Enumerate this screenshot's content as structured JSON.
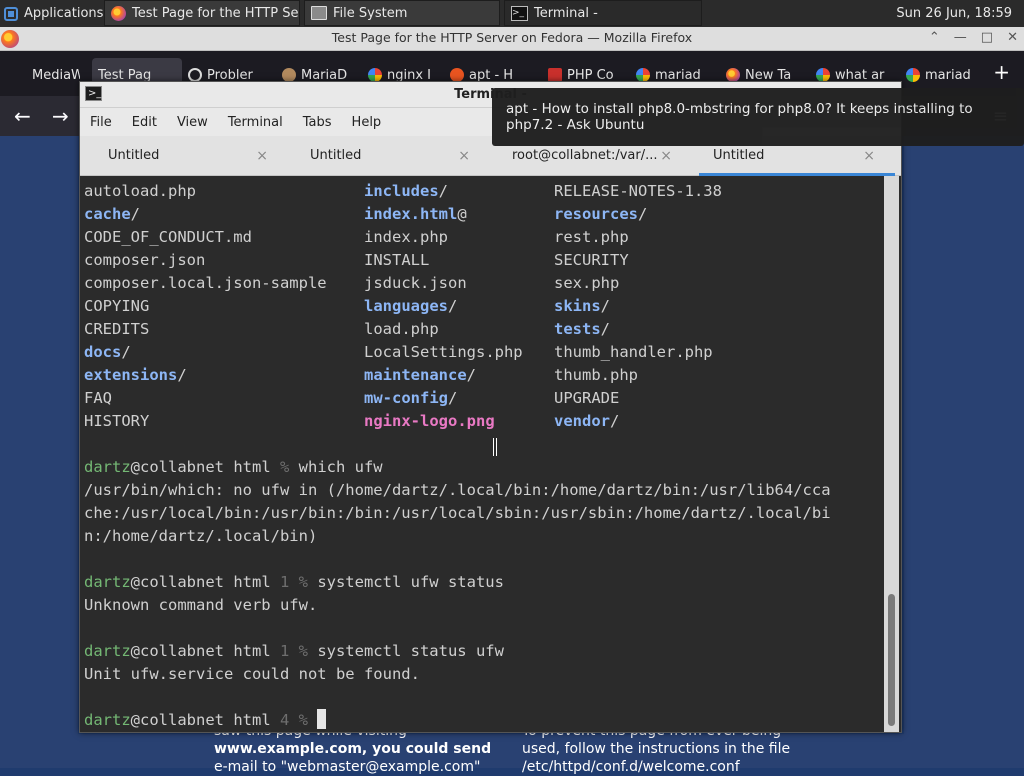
{
  "panel": {
    "apps_label": "Applications",
    "tasks": [
      {
        "label": "Test Page for the HTTP Se..."
      },
      {
        "label": "File System"
      },
      {
        "label": "Terminal -"
      }
    ],
    "clock": "Sun 26 Jun, 18:59"
  },
  "firefox": {
    "window_title": "Test Page for the HTTP Server on Fedora — Mozilla Firefox",
    "tabs": [
      {
        "label": "MediaW"
      },
      {
        "label": "Test Pag"
      },
      {
        "label": "Probler"
      },
      {
        "label": "MariaD"
      },
      {
        "label": "nginx I"
      },
      {
        "label": "apt - H"
      },
      {
        "label": "PHP Co"
      },
      {
        "label": "mariad"
      },
      {
        "label": "New Ta"
      },
      {
        "label": "what ar"
      },
      {
        "label": "mariad"
      }
    ],
    "new_tab": "+",
    "back": "←",
    "forward": "→",
    "menu": "≡",
    "page_left_text": [
      "saw this page while visiting",
      "www.example.com, you could send",
      "e-mail to \"webmaster@example.com\""
    ],
    "page_right_text": [
      "To prevent this page from ever being",
      "used, follow the instructions in the file",
      "/etc/httpd/conf.d/welcome.conf"
    ]
  },
  "tooltip": {
    "text": "apt - How to install php8.0-mbstring for php8.0? It keeps installing to php7.2 - Ask Ubuntu"
  },
  "terminal": {
    "title": "Terminal -",
    "menu": [
      "File",
      "Edit",
      "View",
      "Terminal",
      "Tabs",
      "Help"
    ],
    "tabs": [
      "Untitled",
      "Untitled",
      "root@collabnet:/var/...",
      "Untitled"
    ],
    "tab_close": "×",
    "listing": [
      [
        {
          "t": "autoload.php",
          "k": "file"
        },
        {
          "t": "includes",
          "k": "dir",
          "s": "/"
        },
        {
          "t": "RELEASE-NOTES-1.38",
          "k": "file"
        }
      ],
      [
        {
          "t": "cache",
          "k": "dir",
          "s": "/"
        },
        {
          "t": "index.html",
          "k": "dir",
          "s": "@"
        },
        {
          "t": "resources",
          "k": "dir",
          "s": "/"
        }
      ],
      [
        {
          "t": "CODE_OF_CONDUCT.md",
          "k": "file"
        },
        {
          "t": "index.php",
          "k": "file"
        },
        {
          "t": "rest.php",
          "k": "file"
        }
      ],
      [
        {
          "t": "composer.json",
          "k": "file"
        },
        {
          "t": "INSTALL",
          "k": "file"
        },
        {
          "t": "SECURITY",
          "k": "file"
        }
      ],
      [
        {
          "t": "composer.local.json-sample",
          "k": "file"
        },
        {
          "t": "jsduck.json",
          "k": "file"
        },
        {
          "t": "sex.php",
          "k": "file"
        }
      ],
      [
        {
          "t": "COPYING",
          "k": "file"
        },
        {
          "t": "languages",
          "k": "dir",
          "s": "/"
        },
        {
          "t": "skins",
          "k": "dir",
          "s": "/"
        }
      ],
      [
        {
          "t": "CREDITS",
          "k": "file"
        },
        {
          "t": "load.php",
          "k": "file"
        },
        {
          "t": "tests",
          "k": "dir",
          "s": "/"
        }
      ],
      [
        {
          "t": "docs",
          "k": "dir",
          "s": "/"
        },
        {
          "t": "LocalSettings.php",
          "k": "file"
        },
        {
          "t": "thumb_handler.php",
          "k": "file"
        }
      ],
      [
        {
          "t": "extensions",
          "k": "dir",
          "s": "/"
        },
        {
          "t": "maintenance",
          "k": "dir",
          "s": "/"
        },
        {
          "t": "thumb.php",
          "k": "file"
        }
      ],
      [
        {
          "t": "FAQ",
          "k": "file"
        },
        {
          "t": "mw-config",
          "k": "dir",
          "s": "/"
        },
        {
          "t": "UPGRADE",
          "k": "file"
        }
      ],
      [
        {
          "t": "HISTORY",
          "k": "file"
        },
        {
          "t": "nginx-logo.png",
          "k": "png"
        },
        {
          "t": "vendor",
          "k": "dir",
          "s": "/"
        }
      ]
    ],
    "session": [
      {
        "user": "dartz",
        "host": "@collabnet html ",
        "ret": "",
        "sym": "% ",
        "cmd": "which ufw"
      },
      {
        "out": "/usr/bin/which: no ufw in (/home/dartz/.local/bin:/home/dartz/bin:/usr/lib64/cca"
      },
      {
        "out": "che:/usr/local/bin:/usr/bin:/bin:/usr/local/sbin:/usr/sbin:/home/dartz/.local/bi"
      },
      {
        "out": "n:/home/dartz/.local/bin)"
      },
      {
        "user": "dartz",
        "host": "@collabnet html ",
        "ret": "1 ",
        "sym": "% ",
        "cmd": "systemctl ufw status"
      },
      {
        "out": "Unknown command verb ufw."
      },
      {
        "user": "dartz",
        "host": "@collabnet html ",
        "ret": "1 ",
        "sym": "% ",
        "cmd": "systemctl status ufw"
      },
      {
        "out": "Unit ufw.service could not be found."
      },
      {
        "user": "dartz",
        "host": "@collabnet html ",
        "ret": "4 ",
        "sym": "% ",
        "cmd": ""
      }
    ]
  }
}
